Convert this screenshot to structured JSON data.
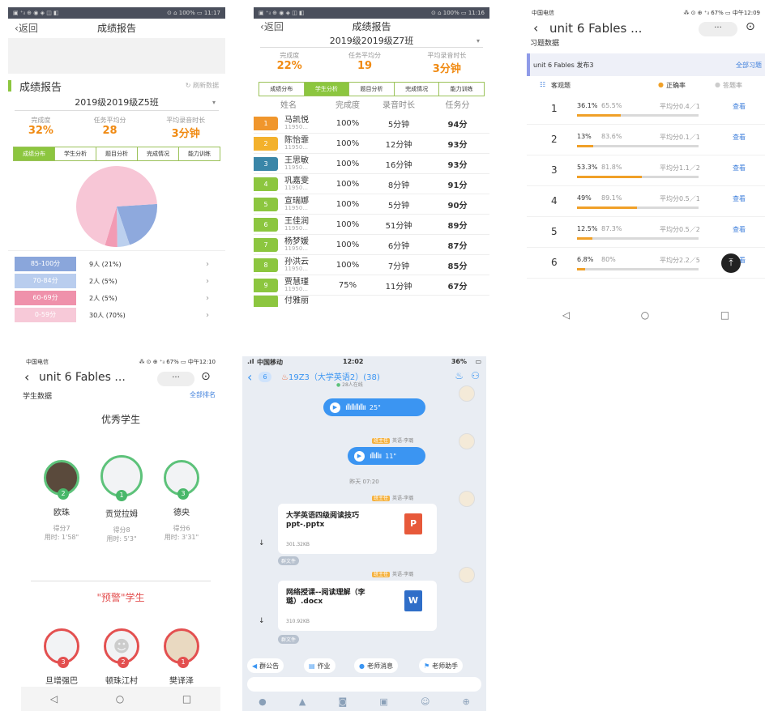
{
  "s1": {
    "status_left": "▣ ⁺ᵢₗ ⊕ ◉ ◈ ◫ ◧",
    "status_right": "⊙ ⌂ 100% ▭ 11:17",
    "back": "返回",
    "title": "成绩报告",
    "section_title": "成绩报告",
    "refresh": "刷新数据",
    "class_name": "2019级2019级Z5班",
    "stats": [
      {
        "label": "完成度",
        "value": "32%"
      },
      {
        "label": "任务平均分",
        "value": "28"
      },
      {
        "label": "平均录音时长",
        "value": "3分钟"
      }
    ],
    "tabs": [
      "成绩分布",
      "学生分析",
      "题目分析",
      "完成情况",
      "能力训练"
    ],
    "pie": [
      {
        "label": "85-100分",
        "value": 21,
        "color": "#8ea9dd"
      },
      {
        "label": "70-84分",
        "value": 5,
        "color": "#bcd0ee"
      },
      {
        "label": "60-69分",
        "value": 5,
        "color": "#f29bb4"
      },
      {
        "label": "0-59分",
        "value": 70,
        "color": "#f7c6d6"
      }
    ],
    "dist": [
      {
        "range": "85-100分",
        "count": "9人 (21%)",
        "color": "#8aa6db"
      },
      {
        "range": "70-84分",
        "count": "2人 (5%)",
        "color": "#b9cdee"
      },
      {
        "range": "60-69分",
        "count": "2人 (5%)",
        "color": "#ef91ab"
      },
      {
        "range": "0-59分",
        "count": "30人 (70%)",
        "color": "#f7c9d8"
      }
    ]
  },
  "s2": {
    "status_left": "▣ ⁺ᵢₗ ⊕ ◉ ◈ ◫ ◧",
    "status_right": "⊙ ⌂ 100% ▭ 11:16",
    "back": "返回",
    "title": "成绩报告",
    "class_name": "2019级2019级Z7班",
    "stats": [
      {
        "label": "完成度",
        "value": "22%"
      },
      {
        "label": "任务平均分",
        "value": "19"
      },
      {
        "label": "平均录音时长",
        "value": "3分钟"
      }
    ],
    "tabs": [
      "成绩分布",
      "学生分析",
      "题目分析",
      "完成情况",
      "能力训练"
    ],
    "columns": [
      "姓名",
      "完成度",
      "录音时长",
      "任务分"
    ],
    "rows": [
      {
        "rank": "1",
        "name": "马凯悦",
        "id": "11950...",
        "done": "100%",
        "time": "5分钟",
        "score": "94分",
        "color": "#f0962c"
      },
      {
        "rank": "2",
        "name": "陈怡霏",
        "id": "11950...",
        "done": "100%",
        "time": "12分钟",
        "score": "93分",
        "color": "#f3b12c"
      },
      {
        "rank": "3",
        "name": "王思敏",
        "id": "11950...",
        "done": "100%",
        "time": "16分钟",
        "score": "93分",
        "color": "#3a86a8"
      },
      {
        "rank": "4",
        "name": "巩嘉雯",
        "id": "11950...",
        "done": "100%",
        "time": "8分钟",
        "score": "91分",
        "color": "#8cc63f"
      },
      {
        "rank": "5",
        "name": "宣瑞娜",
        "id": "11950...",
        "done": "100%",
        "time": "5分钟",
        "score": "90分",
        "color": "#8cc63f"
      },
      {
        "rank": "6",
        "name": "王佳润",
        "id": "11950...",
        "done": "100%",
        "time": "51分钟",
        "score": "89分",
        "color": "#8cc63f"
      },
      {
        "rank": "7",
        "name": "杨梦媛",
        "id": "11950...",
        "done": "100%",
        "time": "6分钟",
        "score": "87分",
        "color": "#8cc63f"
      },
      {
        "rank": "8",
        "name": "孙洪云",
        "id": "11950...",
        "done": "100%",
        "time": "7分钟",
        "score": "85分",
        "color": "#8cc63f"
      },
      {
        "rank": "9",
        "name": "贾慧瑾",
        "id": "11950...",
        "done": "75%",
        "time": "11分钟",
        "score": "67分",
        "color": "#8cc63f"
      }
    ],
    "partial_row": "付雅丽"
  },
  "s3": {
    "status_left": "中国电信",
    "status_right": "⁂ ⊙ ⊕ ⁺ᵢₗ 67% ▭ 中午12:09",
    "title": "unit 6 Fables ...",
    "menu": "···",
    "section": "习题数据",
    "task_name": "unit 6 Fables 发布3",
    "all_link": "全部习题",
    "category": "客观题",
    "legend_correct": "正确率",
    "legend_answer": "答题率",
    "view_label": "查看",
    "questions": [
      {
        "num": "1",
        "correct": "36.1%",
        "answer": "65.5%",
        "avg": "平均分0.4／1",
        "fill": 0.36
      },
      {
        "num": "2",
        "correct": "13%",
        "answer": "83.6%",
        "avg": "平均分0.1／1",
        "fill": 0.13
      },
      {
        "num": "3",
        "correct": "53.3%",
        "answer": "81.8%",
        "avg": "平均分1.1／2",
        "fill": 0.53
      },
      {
        "num": "4",
        "correct": "49%",
        "answer": "89.1%",
        "avg": "平均分0.5／1",
        "fill": 0.49
      },
      {
        "num": "5",
        "correct": "12.5%",
        "answer": "87.3%",
        "avg": "平均分0.5／2",
        "fill": 0.125
      },
      {
        "num": "6",
        "correct": "6.8%",
        "answer": "80%",
        "avg": "平均分2.2／5",
        "fill": 0.068
      }
    ],
    "nav": [
      "◁",
      "○",
      "□"
    ]
  },
  "s4": {
    "status_left": "中国电信",
    "status_right": "⁂ ⊙ ⊕ ⁺ᵢₗ 67% ▭ 中午12:10",
    "title": "unit 6 Fables ...",
    "menu": "···",
    "section": "学生数据",
    "all_rank": "全部排名",
    "excellent_title": "优秀学生",
    "warning_title": "\"预警\"学生",
    "top": [
      {
        "badge": "2",
        "name": "欧珠",
        "score": "得分7",
        "time": "用时: 1'58\""
      },
      {
        "badge": "1",
        "name": "贡觉拉姆",
        "score": "得分8",
        "time": "用时: 5'3\""
      },
      {
        "badge": "3",
        "name": "德央",
        "score": "得分6",
        "time": "用时: 3'31\""
      }
    ],
    "warn": [
      {
        "badge": "3",
        "name": "旦增强巴"
      },
      {
        "badge": "2",
        "name": "顿珠江村"
      },
      {
        "badge": "1",
        "name": "樊译泽"
      }
    ],
    "nav": [
      "◁",
      "○",
      "□"
    ]
  },
  "s5": {
    "status_left": "中国移动",
    "time": "12:02",
    "battery": "36%",
    "back_count": "6",
    "group_name": "19Z3（大学英语2）(38)",
    "online": "28人在线",
    "sender_role": "班主任",
    "sender_name": "英语-李璐",
    "voice1": "25\"",
    "voice2": "11\"",
    "timestamp": "昨天 07:20",
    "file1": {
      "name": "大学英语四级阅读技巧ppt-.pptx",
      "size": "301.32KB",
      "icon": "P"
    },
    "file2": {
      "name": "网络授课--阅读理解（李璐）.docx",
      "size": "310.92KB",
      "icon": "W"
    },
    "group_file_tag": "群文件",
    "quick": [
      "群公告",
      "作业",
      "老师消息",
      "老师助手"
    ]
  }
}
